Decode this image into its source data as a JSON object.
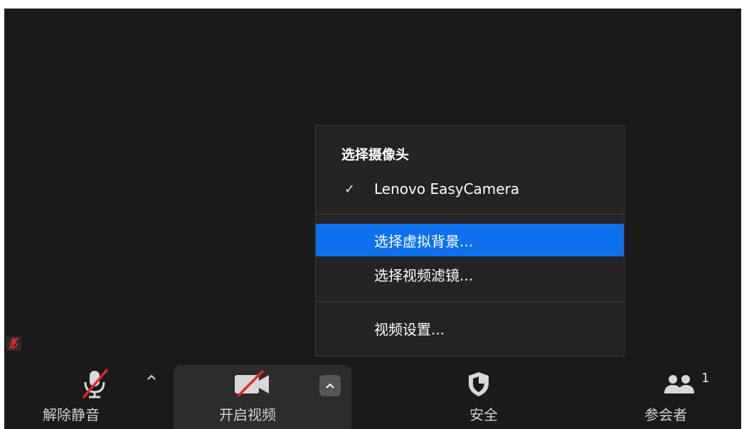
{
  "menu": {
    "header": "选择摄像头",
    "items": [
      {
        "label": "Lenovo EasyCamera",
        "checked": true
      },
      {
        "label": "选择虚拟背景...",
        "highlighted": true
      },
      {
        "label": "选择视频滤镜..."
      },
      {
        "label": "视频设置..."
      }
    ],
    "check_glyph": "✓"
  },
  "toolbar": {
    "unmute_label": "解除静音",
    "start_video_label": "开启视频",
    "security_label": "安全",
    "participants_label": "参会者",
    "participants_count": "1"
  },
  "icons": {
    "self_mute": "muted-mic-icon",
    "unmute": "muted-mic-icon",
    "video": "video-off-icon",
    "security": "shield-icon",
    "participants": "participants-icon",
    "caret": "chevron-up-icon"
  },
  "colors": {
    "background": "#1a1a1a",
    "menu_bg": "#232323",
    "highlight": "#0e71eb",
    "mute_red": "#e02828"
  }
}
